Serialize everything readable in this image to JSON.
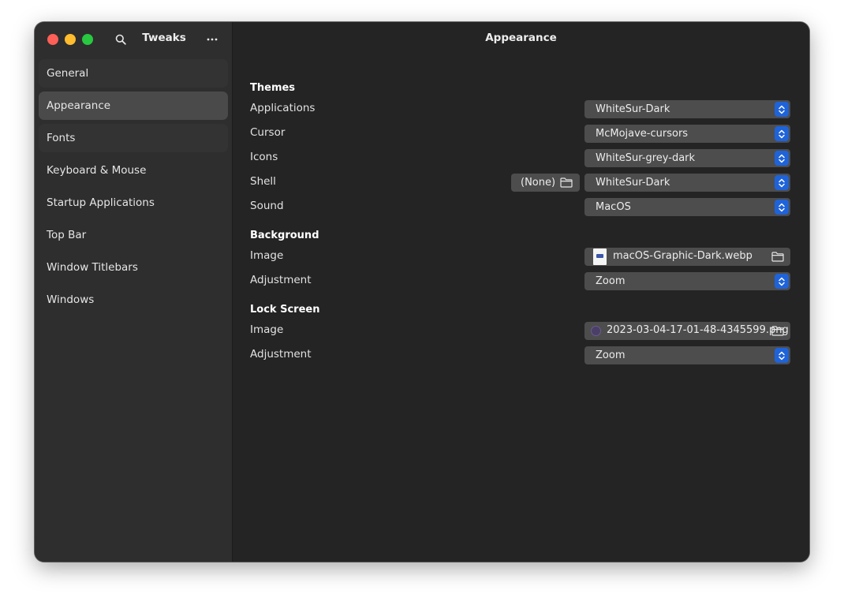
{
  "app": {
    "title": "Tweaks",
    "page_title": "Appearance"
  },
  "sidebar": {
    "items": [
      {
        "label": "General"
      },
      {
        "label": "Appearance",
        "selected": true
      },
      {
        "label": "Fonts"
      },
      {
        "label": "Keyboard & Mouse"
      },
      {
        "label": "Startup Applications"
      },
      {
        "label": "Top Bar"
      },
      {
        "label": "Window Titlebars"
      },
      {
        "label": "Windows"
      }
    ]
  },
  "themes": {
    "heading": "Themes",
    "applications": {
      "label": "Applications",
      "value": "WhiteSur-Dark"
    },
    "cursor": {
      "label": "Cursor",
      "value": "McMojave-cursors"
    },
    "icons": {
      "label": "Icons",
      "value": "WhiteSur-grey-dark"
    },
    "shell": {
      "label": "Shell",
      "file": "(None)",
      "value": "WhiteSur-Dark"
    },
    "sound": {
      "label": "Sound",
      "value": "MacOS"
    }
  },
  "background": {
    "heading": "Background",
    "image": {
      "label": "Image",
      "value": "macOS-Graphic-Dark.webp"
    },
    "adjustment": {
      "label": "Adjustment",
      "value": "Zoom"
    }
  },
  "lock_screen": {
    "heading": "Lock Screen",
    "image": {
      "label": "Image",
      "value": "2023-03-04-17-01-48-4345599.png"
    },
    "adjustment": {
      "label": "Adjustment",
      "value": "Zoom"
    }
  },
  "colors": {
    "accent": "#1f63d9",
    "window_bg": "#242424",
    "sidebar_bg": "#2e2e2e",
    "close": "#fe5f57",
    "minimize": "#febc2e",
    "maximize": "#28c840"
  },
  "icons": [
    "search-icon",
    "more-icon",
    "chevron-updown-icon",
    "folder-icon",
    "image-file-icon"
  ]
}
